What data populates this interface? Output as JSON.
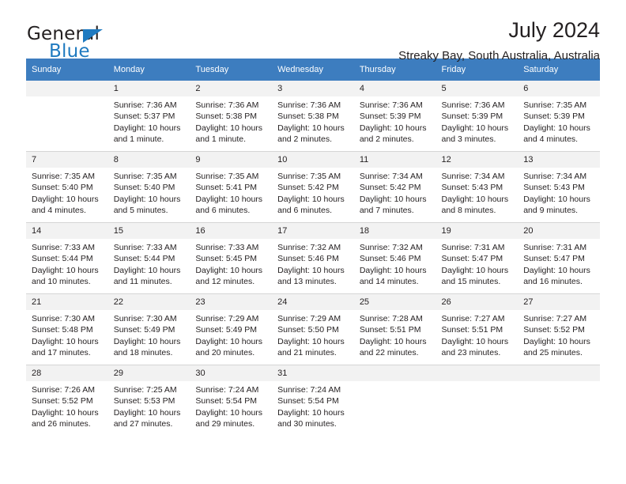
{
  "brand": {
    "name_part1": "General",
    "name_part2": "Blue",
    "triangle_color": "#1f7ac0"
  },
  "header": {
    "title": "July 2024",
    "subtitle": "Streaky Bay, South Australia, Australia"
  },
  "theme": {
    "header_bar_color": "#3d7dbf",
    "daynum_bg": "#f2f2f2",
    "text_color": "#231f20"
  },
  "calendar": {
    "weekday_headers": [
      "Sunday",
      "Monday",
      "Tuesday",
      "Wednesday",
      "Thursday",
      "Friday",
      "Saturday"
    ],
    "weeks": [
      [
        {
          "day": "",
          "lines": []
        },
        {
          "day": "1",
          "lines": [
            "Sunrise: 7:36 AM",
            "Sunset: 5:37 PM",
            "Daylight: 10 hours",
            "and 1 minute."
          ]
        },
        {
          "day": "2",
          "lines": [
            "Sunrise: 7:36 AM",
            "Sunset: 5:38 PM",
            "Daylight: 10 hours",
            "and 1 minute."
          ]
        },
        {
          "day": "3",
          "lines": [
            "Sunrise: 7:36 AM",
            "Sunset: 5:38 PM",
            "Daylight: 10 hours",
            "and 2 minutes."
          ]
        },
        {
          "day": "4",
          "lines": [
            "Sunrise: 7:36 AM",
            "Sunset: 5:39 PM",
            "Daylight: 10 hours",
            "and 2 minutes."
          ]
        },
        {
          "day": "5",
          "lines": [
            "Sunrise: 7:36 AM",
            "Sunset: 5:39 PM",
            "Daylight: 10 hours",
            "and 3 minutes."
          ]
        },
        {
          "day": "6",
          "lines": [
            "Sunrise: 7:35 AM",
            "Sunset: 5:39 PM",
            "Daylight: 10 hours",
            "and 4 minutes."
          ]
        }
      ],
      [
        {
          "day": "7",
          "lines": [
            "Sunrise: 7:35 AM",
            "Sunset: 5:40 PM",
            "Daylight: 10 hours",
            "and 4 minutes."
          ]
        },
        {
          "day": "8",
          "lines": [
            "Sunrise: 7:35 AM",
            "Sunset: 5:40 PM",
            "Daylight: 10 hours",
            "and 5 minutes."
          ]
        },
        {
          "day": "9",
          "lines": [
            "Sunrise: 7:35 AM",
            "Sunset: 5:41 PM",
            "Daylight: 10 hours",
            "and 6 minutes."
          ]
        },
        {
          "day": "10",
          "lines": [
            "Sunrise: 7:35 AM",
            "Sunset: 5:42 PM",
            "Daylight: 10 hours",
            "and 6 minutes."
          ]
        },
        {
          "day": "11",
          "lines": [
            "Sunrise: 7:34 AM",
            "Sunset: 5:42 PM",
            "Daylight: 10 hours",
            "and 7 minutes."
          ]
        },
        {
          "day": "12",
          "lines": [
            "Sunrise: 7:34 AM",
            "Sunset: 5:43 PM",
            "Daylight: 10 hours",
            "and 8 minutes."
          ]
        },
        {
          "day": "13",
          "lines": [
            "Sunrise: 7:34 AM",
            "Sunset: 5:43 PM",
            "Daylight: 10 hours",
            "and 9 minutes."
          ]
        }
      ],
      [
        {
          "day": "14",
          "lines": [
            "Sunrise: 7:33 AM",
            "Sunset: 5:44 PM",
            "Daylight: 10 hours",
            "and 10 minutes."
          ]
        },
        {
          "day": "15",
          "lines": [
            "Sunrise: 7:33 AM",
            "Sunset: 5:44 PM",
            "Daylight: 10 hours",
            "and 11 minutes."
          ]
        },
        {
          "day": "16",
          "lines": [
            "Sunrise: 7:33 AM",
            "Sunset: 5:45 PM",
            "Daylight: 10 hours",
            "and 12 minutes."
          ]
        },
        {
          "day": "17",
          "lines": [
            "Sunrise: 7:32 AM",
            "Sunset: 5:46 PM",
            "Daylight: 10 hours",
            "and 13 minutes."
          ]
        },
        {
          "day": "18",
          "lines": [
            "Sunrise: 7:32 AM",
            "Sunset: 5:46 PM",
            "Daylight: 10 hours",
            "and 14 minutes."
          ]
        },
        {
          "day": "19",
          "lines": [
            "Sunrise: 7:31 AM",
            "Sunset: 5:47 PM",
            "Daylight: 10 hours",
            "and 15 minutes."
          ]
        },
        {
          "day": "20",
          "lines": [
            "Sunrise: 7:31 AM",
            "Sunset: 5:47 PM",
            "Daylight: 10 hours",
            "and 16 minutes."
          ]
        }
      ],
      [
        {
          "day": "21",
          "lines": [
            "Sunrise: 7:30 AM",
            "Sunset: 5:48 PM",
            "Daylight: 10 hours",
            "and 17 minutes."
          ]
        },
        {
          "day": "22",
          "lines": [
            "Sunrise: 7:30 AM",
            "Sunset: 5:49 PM",
            "Daylight: 10 hours",
            "and 18 minutes."
          ]
        },
        {
          "day": "23",
          "lines": [
            "Sunrise: 7:29 AM",
            "Sunset: 5:49 PM",
            "Daylight: 10 hours",
            "and 20 minutes."
          ]
        },
        {
          "day": "24",
          "lines": [
            "Sunrise: 7:29 AM",
            "Sunset: 5:50 PM",
            "Daylight: 10 hours",
            "and 21 minutes."
          ]
        },
        {
          "day": "25",
          "lines": [
            "Sunrise: 7:28 AM",
            "Sunset: 5:51 PM",
            "Daylight: 10 hours",
            "and 22 minutes."
          ]
        },
        {
          "day": "26",
          "lines": [
            "Sunrise: 7:27 AM",
            "Sunset: 5:51 PM",
            "Daylight: 10 hours",
            "and 23 minutes."
          ]
        },
        {
          "day": "27",
          "lines": [
            "Sunrise: 7:27 AM",
            "Sunset: 5:52 PM",
            "Daylight: 10 hours",
            "and 25 minutes."
          ]
        }
      ],
      [
        {
          "day": "28",
          "lines": [
            "Sunrise: 7:26 AM",
            "Sunset: 5:52 PM",
            "Daylight: 10 hours",
            "and 26 minutes."
          ]
        },
        {
          "day": "29",
          "lines": [
            "Sunrise: 7:25 AM",
            "Sunset: 5:53 PM",
            "Daylight: 10 hours",
            "and 27 minutes."
          ]
        },
        {
          "day": "30",
          "lines": [
            "Sunrise: 7:24 AM",
            "Sunset: 5:54 PM",
            "Daylight: 10 hours",
            "and 29 minutes."
          ]
        },
        {
          "day": "31",
          "lines": [
            "Sunrise: 7:24 AM",
            "Sunset: 5:54 PM",
            "Daylight: 10 hours",
            "and 30 minutes."
          ]
        },
        {
          "day": "",
          "lines": []
        },
        {
          "day": "",
          "lines": []
        },
        {
          "day": "",
          "lines": []
        }
      ]
    ]
  }
}
